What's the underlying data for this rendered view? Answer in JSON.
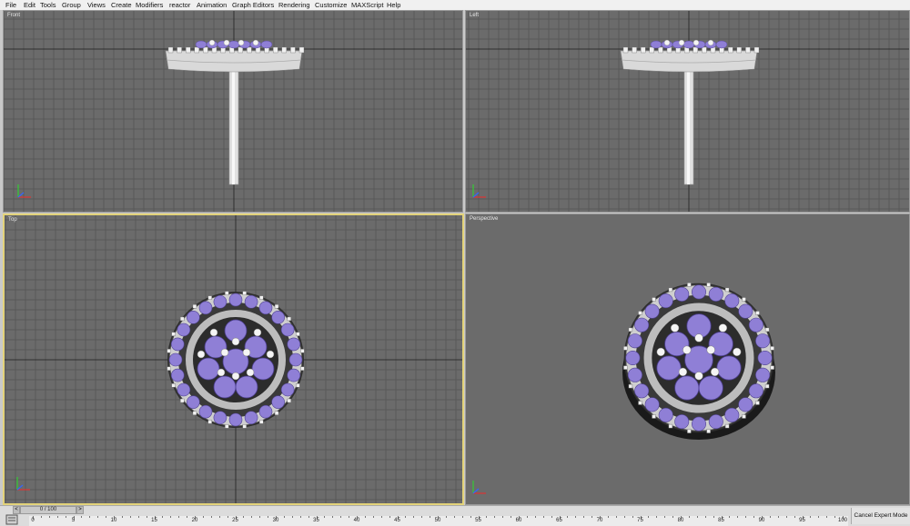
{
  "menu": [
    "File",
    "Edit",
    "Tools",
    "Group",
    "Views",
    "Create",
    "Modifiers",
    "reactor",
    "Animation",
    "Graph Editors",
    "Rendering",
    "Customize",
    "MAXScript",
    "Help"
  ],
  "viewports": {
    "front": {
      "label": "Front"
    },
    "left": {
      "label": "Left"
    },
    "top": {
      "label": "Top"
    },
    "perspective": {
      "label": "Perspective"
    }
  },
  "timeline": {
    "frame_counter": "0 / 100",
    "prev_label": "<",
    "next_label": ">",
    "ticks": [
      "0",
      "5",
      "10",
      "15",
      "20",
      "25",
      "30",
      "35",
      "40",
      "45",
      "50",
      "55",
      "60",
      "65",
      "70",
      "75",
      "80",
      "85",
      "90",
      "95",
      "100"
    ]
  },
  "expert_button": "Cancel Expert Mode",
  "colors": {
    "viewport_bg": "#6b6b6b",
    "grid": "#585858",
    "gem": "#8f7fd6",
    "metal": "#e6e6e6",
    "active_border": "#e3d37a"
  }
}
